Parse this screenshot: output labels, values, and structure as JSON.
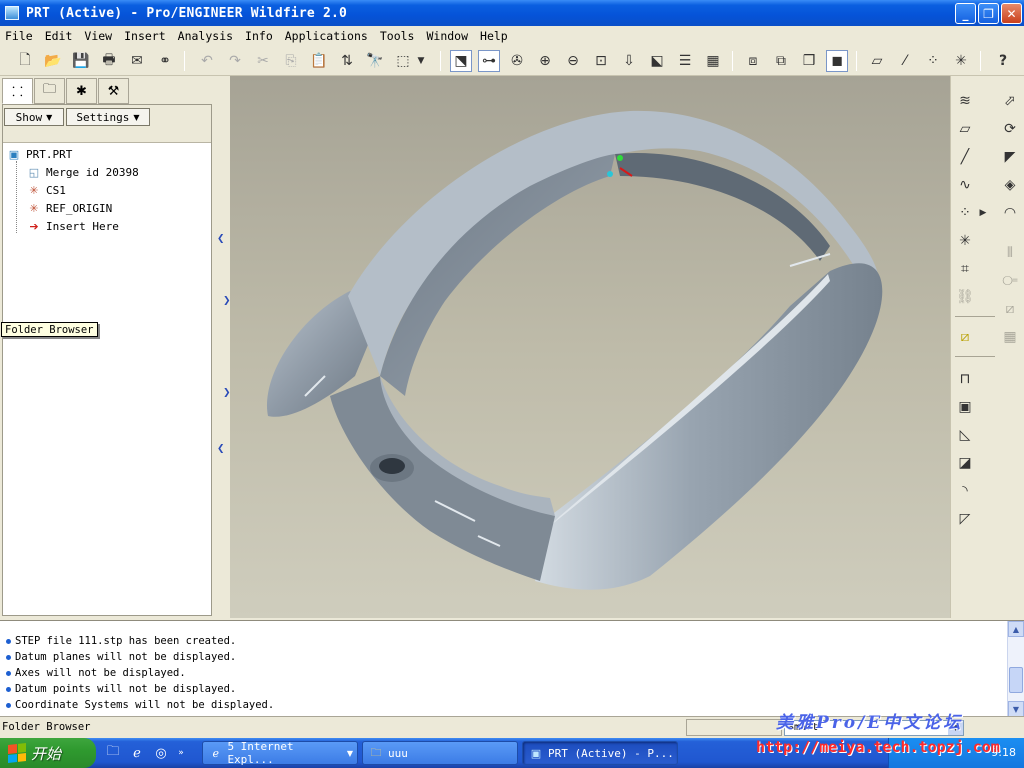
{
  "window": {
    "title": "PRT (Active) - Pro/ENGINEER Wildfire 2.0",
    "buttons": {
      "minimize": "_",
      "maximize": "❐",
      "close": "✕"
    }
  },
  "menu": [
    "File",
    "Edit",
    "View",
    "Insert",
    "Analysis",
    "Info",
    "Applications",
    "Tools",
    "Window",
    "Help"
  ],
  "navigator": {
    "tabs": [
      "model-tree",
      "folder-browser",
      "favorites",
      "connections"
    ],
    "show_label": "Show",
    "settings_label": "Settings",
    "tree": {
      "root": "PRT.PRT",
      "items": [
        "Merge id 20398",
        "CS1",
        "REF_ORIGIN",
        "Insert Here"
      ]
    },
    "tooltip": "Folder Browser"
  },
  "messages": [
    "STEP file 111.stp has been created.",
    "Datum planes will not be displayed.",
    "Axes will not be displayed.",
    "Datum points will not be displayed.",
    "Coordinate Systems will not be displayed."
  ],
  "status": {
    "text": "Folder Browser",
    "filter": "Smart"
  },
  "taskbar": {
    "start": "开始",
    "tasks": [
      "5 Internet Expl...",
      "uuu",
      "PRT (Active) - P..."
    ],
    "clock": "9:18"
  },
  "watermark": {
    "line1": "美雅Pro/E中文论坛",
    "line2": "http://meiya.tech.topzj.com"
  },
  "colors": {
    "titlebar": "#0553d8",
    "graphics_bg": "#bebba9",
    "model_surface": "#8894a0"
  }
}
